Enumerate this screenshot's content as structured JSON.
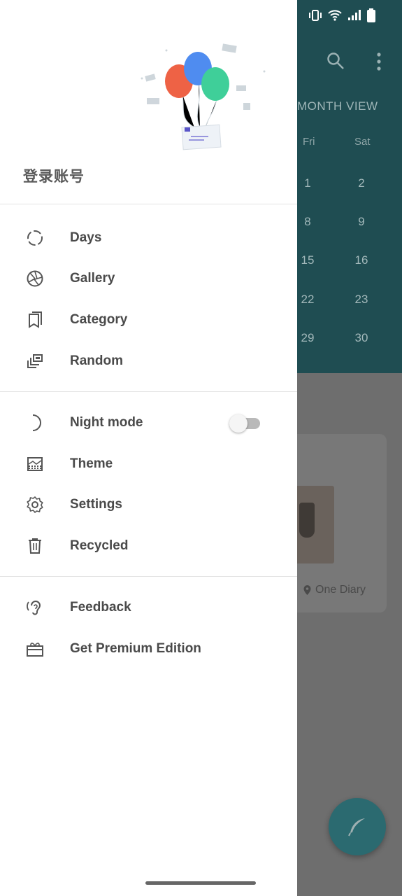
{
  "background": {
    "month_view_label": "MONTH VIEW",
    "weekdays": [
      "Fri",
      "Sat"
    ],
    "calendar_rows": [
      [
        "1",
        "2"
      ],
      [
        "8",
        "9"
      ],
      [
        "15",
        "16"
      ],
      [
        "22",
        "23"
      ],
      [
        "29",
        "30"
      ]
    ],
    "card_location": "One Diary",
    "colors": {
      "header": "#1f4d52",
      "fab": "#2b6a70"
    }
  },
  "drawer": {
    "login_label": "登录账号",
    "section1": [
      {
        "label": "Days",
        "icon": "loading-circle-icon"
      },
      {
        "label": "Gallery",
        "icon": "aperture-icon"
      },
      {
        "label": "Category",
        "icon": "bookmark-icon"
      },
      {
        "label": "Random",
        "icon": "shuffle-cards-icon"
      }
    ],
    "section2": [
      {
        "label": "Night mode",
        "icon": "moon-icon",
        "toggle": false
      },
      {
        "label": "Theme",
        "icon": "theme-icon"
      },
      {
        "label": "Settings",
        "icon": "gear-icon"
      },
      {
        "label": "Recycled",
        "icon": "trash-icon"
      }
    ],
    "section3": [
      {
        "label": "Feedback",
        "icon": "ear-icon"
      },
      {
        "label": "Get Premium Edition",
        "icon": "gift-icon"
      }
    ]
  }
}
